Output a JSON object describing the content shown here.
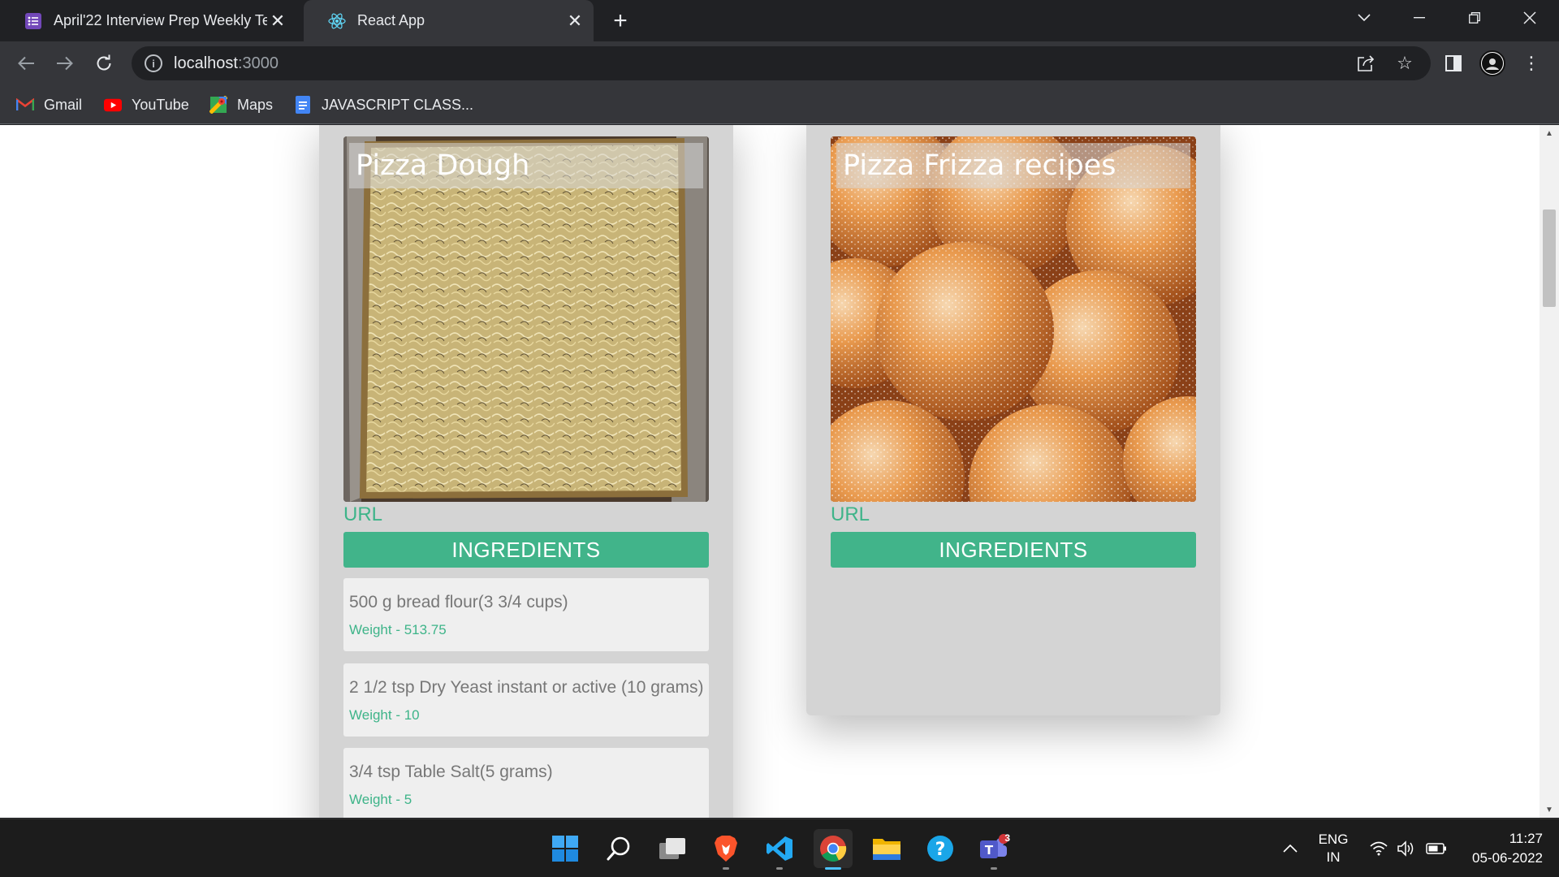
{
  "browser": {
    "tabs": [
      {
        "title": "April'22 Interview Prep Weekly Te",
        "icon": "forms-icon",
        "active": false
      },
      {
        "title": "React App",
        "icon": "react-icon",
        "active": true
      }
    ],
    "address": {
      "host": "localhost",
      "port": ":3000"
    },
    "bookmarks": [
      {
        "label": "Gmail",
        "icon": "gmail-icon"
      },
      {
        "label": "YouTube",
        "icon": "youtube-icon"
      },
      {
        "label": "Maps",
        "icon": "maps-icon"
      },
      {
        "label": "JAVASCRIPT CLASS...",
        "icon": "docs-icon"
      }
    ]
  },
  "page": {
    "cards": [
      {
        "title": "Pizza Dough",
        "url_label": "URL",
        "button_label": "INGREDIENTS",
        "ingredients": [
          {
            "text": "500 g bread flour(3 3/4 cups)",
            "weight": "Weight - 513.75"
          },
          {
            "text": "2 1/2 tsp Dry Yeast instant or active (10 grams)",
            "weight": "Weight - 10"
          },
          {
            "text": "3/4 tsp Table Salt(5 grams)",
            "weight": "Weight - 5"
          }
        ]
      },
      {
        "title": "Pizza Frizza recipes",
        "url_label": "URL",
        "button_label": "INGREDIENTS",
        "ingredients": []
      }
    ]
  },
  "taskbar": {
    "apps": [
      "windows-start-icon",
      "search-icon",
      "task-view-icon",
      "brave-browser-icon",
      "vscode-icon",
      "chrome-icon",
      "file-explorer-icon",
      "help-icon",
      "teams-icon"
    ],
    "teams_badge": "3",
    "language": {
      "line1": "ENG",
      "line2": "IN"
    },
    "time": "11:27",
    "date": "05-06-2022"
  },
  "colors": {
    "accent_green": "#41b48a",
    "card_bg": "#d4d4d4",
    "ingredient_bg": "#efefef"
  }
}
